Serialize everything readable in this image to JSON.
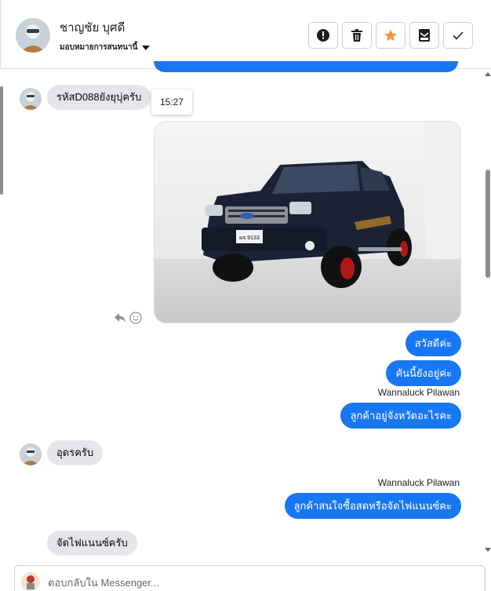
{
  "contact": {
    "name": "ชาญชัย บุศดี",
    "assign_label": "มอบหมายการสนทนานี้"
  },
  "header_actions": [
    {
      "icon": "alert-icon",
      "name": "mark-spam-button"
    },
    {
      "icon": "trash-icon",
      "name": "delete-button"
    },
    {
      "icon": "star-icon",
      "name": "star-button",
      "color": "#f7923b"
    },
    {
      "icon": "envelope-icon",
      "name": "mark-unread-button"
    },
    {
      "icon": "check-icon",
      "name": "mark-done-button"
    }
  ],
  "messages": {
    "m1": {
      "text": "รหัสD088ยังยุบุ่ครับ",
      "time": "15:27"
    },
    "m2": {
      "text": "สวัสดีค่ะ"
    },
    "m3": {
      "text": "คันนี้ยังอยู่ค่ะ"
    },
    "m4": {
      "sender": "Wannaluck Pilawan",
      "text": "ลูกค้าอยู่จังหวัดอะไรคะ"
    },
    "m5": {
      "text": "อุดรครับ"
    },
    "m6": {
      "sender": "Wannaluck Pilawan",
      "text": "ลูกค้าสนใจซื้อสดหรือจัดไฟแนนซ์คะ"
    },
    "m7": {
      "text": "จัดไฟแนนซ์ครับ"
    }
  },
  "photo": {
    "plate": "ผจ 9133"
  },
  "composer": {
    "placeholder": "ตอบกลับใน Messenger..."
  },
  "colors": {
    "accent": "#1877f2",
    "incoming": "#e4e6eb",
    "star": "#f7923b"
  }
}
